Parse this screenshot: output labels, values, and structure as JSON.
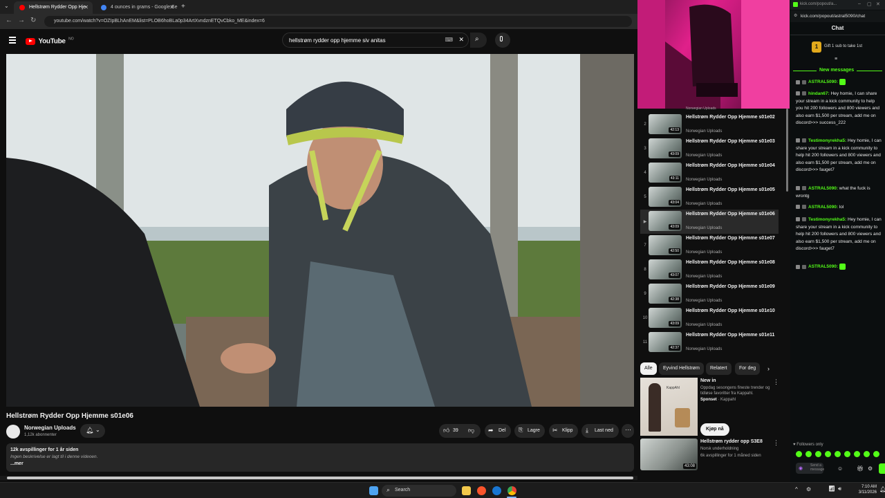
{
  "browser": {
    "tabs": [
      {
        "label": "Hellstrøm Rydder Opp Hje",
        "active": true
      },
      {
        "label": "4 ounces in grams - Google Se",
        "active": false
      }
    ],
    "url": "youtube.com/watch?v=OZIpBLhAnEM&list=PLOB6hoBLa0p34ArtXvndznETQvCbko_ME&index=6"
  },
  "youtube": {
    "logo_text": "YouTube",
    "logo_sup": "NO",
    "search_value": "hellstrøm rydder opp hjemme siv anitas",
    "video": {
      "title": "Hellstrøm Rydder Opp Hjemme s01e06",
      "channel": "Norwegian Uploads",
      "subscribers": "1,12k abonnenter",
      "likes": "39",
      "share": "Del",
      "save": "Lagre",
      "clip": "Klipp",
      "download": "Last ned",
      "views_line": "12k avspillinger  for 1 år siden",
      "description": "Ingen beskrivelse er lagt til i denne videoen.",
      "more": "...mer"
    },
    "playlist": {
      "top_partial_channel": "Norwegian Uploads",
      "items": [
        {
          "num": "2",
          "title": "Hellstrøm Rydder Opp Hjemme s01e02",
          "channel": "Norwegian Uploads",
          "duration": "42:13"
        },
        {
          "num": "3",
          "title": "Hellstrøm Rydder Opp Hjemme s01e03",
          "channel": "Norwegian Uploads",
          "duration": "43:09"
        },
        {
          "num": "4",
          "title": "Hellstrøm Rydder Opp Hjemme s01e04",
          "channel": "Norwegian Uploads",
          "duration": "43:11"
        },
        {
          "num": "5",
          "title": "Hellstrøm Rydder Opp Hjemme s01e05",
          "channel": "Norwegian Uploads",
          "duration": "43:04"
        },
        {
          "num": "▶",
          "title": "Hellstrøm Rydder Opp Hjemme s01e06",
          "channel": "Norwegian Uploads",
          "duration": "43:09",
          "active": true
        },
        {
          "num": "7",
          "title": "Hellstrøm Rydder Opp Hjemme s01e07",
          "channel": "Norwegian Uploads",
          "duration": "42:50"
        },
        {
          "num": "8",
          "title": "Hellstrøm Rydder Opp Hjemme s01e08",
          "channel": "Norwegian Uploads",
          "duration": "43:07"
        },
        {
          "num": "9",
          "title": "Hellstrøm Rydder Opp Hjemme s01e09",
          "channel": "Norwegian Uploads",
          "duration": "42:38"
        },
        {
          "num": "10",
          "title": "Hellstrøm Rydder Opp Hjemme s01e10",
          "channel": "Norwegian Uploads",
          "duration": "43:09"
        },
        {
          "num": "11",
          "title": "Hellstrøm Rydder Opp Hjemme s01e11",
          "channel": "Norwegian Uploads",
          "duration": "42:37"
        }
      ]
    },
    "chips": [
      "Alle",
      "Eyvind Hellstrøm",
      "Relatert",
      "For deg"
    ],
    "ad": {
      "title": "New in",
      "text": "Oppdag sesongens fineste trender og tidløse favoritter fra Kappahl.",
      "sponsor_label": "Sponset",
      "sponsor": "Kappahl",
      "cta": "Kjøp nå",
      "thumb_brand": "KappAhl"
    },
    "rec": {
      "title": "Hellstrøm rydder opp S3E8",
      "channel": "Norsk underholdning",
      "meta": "6k avspillinger  for 1 måned siden",
      "duration": "43:08"
    }
  },
  "chat": {
    "url_top": "kick.com/popout/a...",
    "url": "kick.com/popout/astral5090/chat",
    "header": "Chat",
    "gift_text": "Gift 1 sub to take 1st",
    "gift_count": "1",
    "new_messages": "New messages",
    "messages": [
      {
        "user": "ASTRAL5090:",
        "text": "",
        "color": "#53fc18"
      },
      {
        "user": "hindan67:",
        "text": "Hey homie, I can share your stream in a kick community to help you hit 200 followers and 800 viewers and also earn $1,500 per stream, add me on discord>>> success_222",
        "color": "#53fc18"
      },
      {
        "user": "Testimonyrekha5:",
        "text": "Hey homie, I can share your stream in a kick community to help hit 200 followers and 800 viewers and also earn $1,500 per stream, add me on discord>>> fauget7",
        "color": "#53fc18"
      },
      {
        "user": "ASTRAL5090:",
        "text": "what the fuck is wrontg",
        "color": "#53fc18"
      },
      {
        "user": "ASTRAL5090:",
        "text": "lol",
        "color": "#53fc18"
      },
      {
        "user": "Testimonyrekha5:",
        "text": "Hey homie, I can share your stream in a kick community to help hit 200 followers and 800 viewers and also earn $1,500 per stream, add me on discord>>> fauget7",
        "color": "#53fc18"
      },
      {
        "user": "ASTRAL5090:",
        "text": "",
        "color": "#53fc18"
      }
    ],
    "followers_only": "Followers only",
    "input_placeholder": "Send a message"
  },
  "taskbar": {
    "search_label": "Search",
    "time": "7:10 AM",
    "date": "3/11/2026"
  },
  "colors": {
    "kick_green": "#53fc18",
    "yt_red": "#ff0000"
  }
}
